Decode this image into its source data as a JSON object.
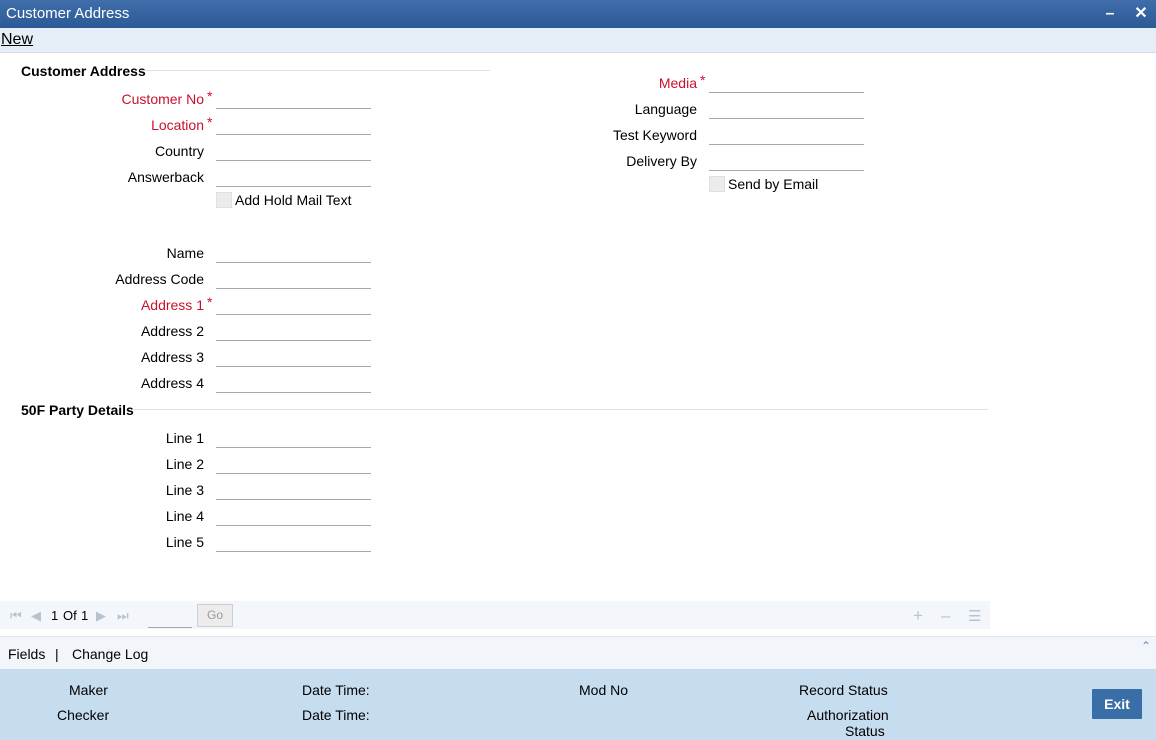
{
  "window": {
    "title": "Customer Address",
    "minimize_icon": "minimize-icon",
    "close_icon": "close-icon"
  },
  "menu": {
    "new_label": "New"
  },
  "section_main": {
    "title": "Customer Address",
    "customer_no": {
      "label": "Customer No",
      "value": ""
    },
    "location": {
      "label": "Location",
      "value": ""
    },
    "country": {
      "label": "Country",
      "value": ""
    },
    "answerback": {
      "label": "Answerback",
      "value": ""
    },
    "add_hold_mail_text": {
      "label": "Add Hold Mail Text",
      "checked": false
    },
    "name": {
      "label": "Name",
      "value": ""
    },
    "address_code": {
      "label": "Address Code",
      "value": ""
    },
    "address1": {
      "label": "Address 1",
      "value": ""
    },
    "address2": {
      "label": "Address 2",
      "value": ""
    },
    "address3": {
      "label": "Address 3",
      "value": ""
    },
    "address4": {
      "label": "Address 4",
      "value": ""
    }
  },
  "section_right": {
    "media": {
      "label": "Media",
      "value": ""
    },
    "language": {
      "label": "Language",
      "value": ""
    },
    "test_keyword": {
      "label": "Test Keyword",
      "value": ""
    },
    "delivery_by": {
      "label": "Delivery By",
      "value": ""
    },
    "send_by_email": {
      "label": "Send by Email",
      "checked": false
    }
  },
  "section_50f": {
    "title": "50F Party Details",
    "lines": [
      {
        "label": "Line 1",
        "value": ""
      },
      {
        "label": "Line 2",
        "value": ""
      },
      {
        "label": "Line 3",
        "value": ""
      },
      {
        "label": "Line 4",
        "value": ""
      },
      {
        "label": "Line 5",
        "value": ""
      }
    ]
  },
  "pager": {
    "current": "1",
    "of_label": "Of",
    "total": "1",
    "go_label": "Go"
  },
  "links": {
    "fields": "Fields",
    "separator": "|",
    "change_log": "Change Log"
  },
  "footer": {
    "maker": "Maker",
    "checker": "Checker",
    "date_time_1": "Date Time:",
    "date_time_2": "Date Time:",
    "mod_no": "Mod No",
    "record_status": "Record Status",
    "authorization": "Authorization",
    "status": "Status",
    "exit_label": "Exit"
  }
}
